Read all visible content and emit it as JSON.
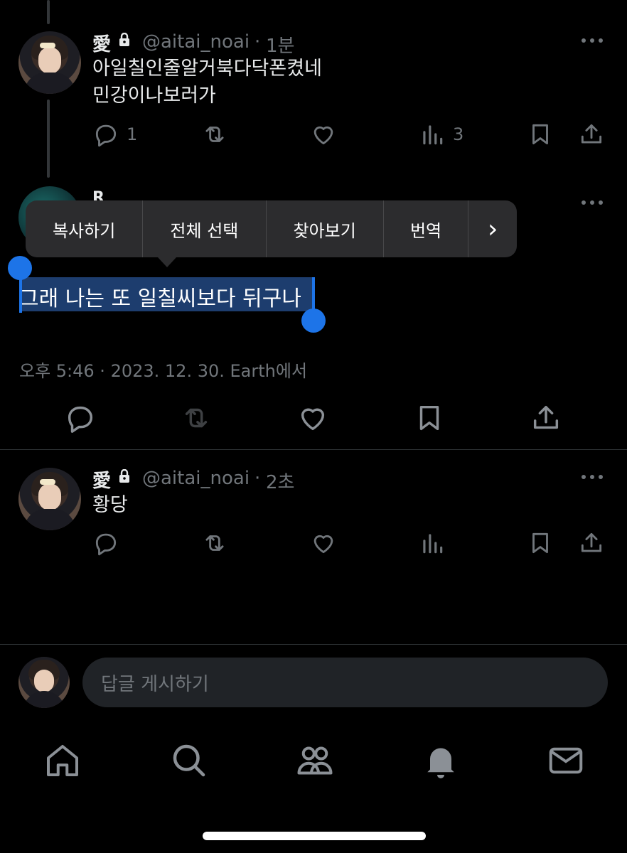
{
  "tweet1": {
    "name": "愛",
    "handle": "@aitai_noai",
    "sep": "·",
    "time": "1분",
    "lines": [
      "아일칠인줄알거북다닥폰켰네",
      "민강이나보러가"
    ],
    "reply_count": "1",
    "views_count": "3"
  },
  "context_menu": {
    "items": [
      "복사하기",
      "전체 선택",
      "찾아보기",
      "번역"
    ],
    "more": "›"
  },
  "main_tweet": {
    "name_partial": "R",
    "selected_text": "그래 나는 또 일칠씨보다 뒤구나",
    "meta": "오후 5:46 · 2023. 12. 30. Earth에서"
  },
  "tweet2": {
    "name": "愛",
    "handle": "@aitai_noai",
    "sep": "·",
    "time": "2초",
    "text": "황당"
  },
  "reply": {
    "placeholder": "답글 게시하기"
  },
  "colors": {
    "background": "#000000",
    "accent": "#1d74e8",
    "muted": "#71767b",
    "text": "#e7e9ea"
  },
  "icons": [
    "reply-icon",
    "retweet-icon",
    "like-icon",
    "views-icon",
    "bookmark-icon",
    "share-icon",
    "home-icon",
    "search-icon",
    "communities-icon",
    "notifications-icon",
    "messages-icon"
  ]
}
